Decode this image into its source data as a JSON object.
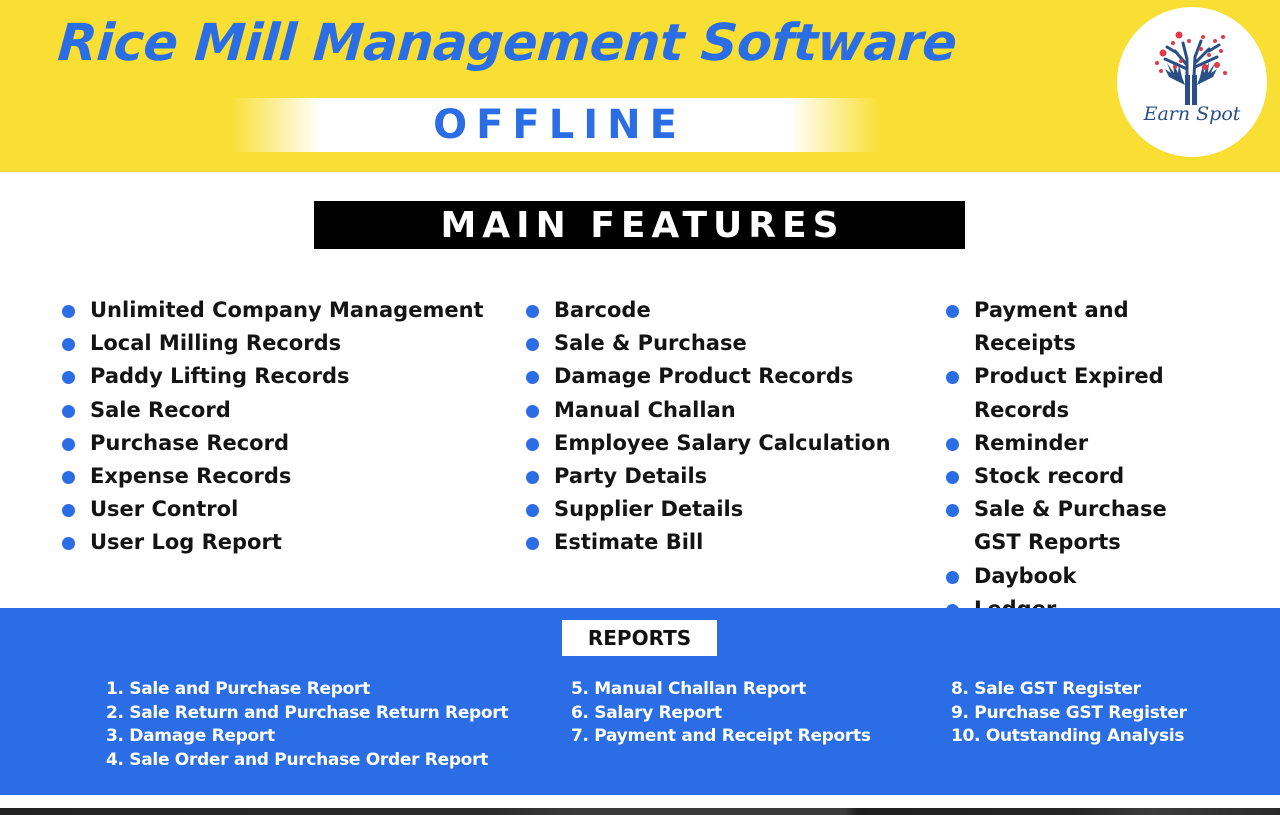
{
  "header": {
    "title": "Rice Mill Management Software",
    "subtitle": "OFFLINE",
    "logo": {
      "icon": "tree-hands-logo-icon",
      "text": "Earn Spot"
    }
  },
  "colors": {
    "header_yellow": "#f9df33",
    "accent_blue": "#2a6de5",
    "heading_black": "#000000",
    "star_red": "#e03a4a",
    "logo_navy": "#2a4f86"
  },
  "features": {
    "heading": "MAIN FEATURES",
    "bullet_icon": "blue-dot-bullet-icon",
    "columns": [
      [
        "Unlimited Company Management",
        "Local Milling Records",
        "Paddy Lifting Records",
        "Sale Record",
        "Purchase Record",
        "Expense Records",
        "User Control",
        "User Log Report"
      ],
      [
        "Barcode",
        "Sale & Purchase",
        "Damage Product Records",
        "Manual Challan",
        "Employee Salary Calculation",
        "Party Details",
        "Supplier Details",
        "Estimate Bill"
      ],
      [
        "Payment and Receipts",
        "Product Expired Records",
        "Reminder",
        "Stock record",
        "Sale & Purchase GST Reports",
        "Daybook",
        "Ledger"
      ]
    ]
  },
  "reports": {
    "heading": "REPORTS",
    "columns": [
      [
        "1. Sale and Purchase Report",
        "2. Sale Return and Purchase Return Report",
        "3. Damage Report",
        "4. Sale Order and Purchase Order Report"
      ],
      [
        "5. Manual Challan Report",
        "6. Salary Report",
        "7. Payment and Receipt Reports"
      ],
      [
        "8. Sale GST Register",
        "9. Purchase GST Register",
        "10. Outstanding Analysis"
      ]
    ]
  }
}
